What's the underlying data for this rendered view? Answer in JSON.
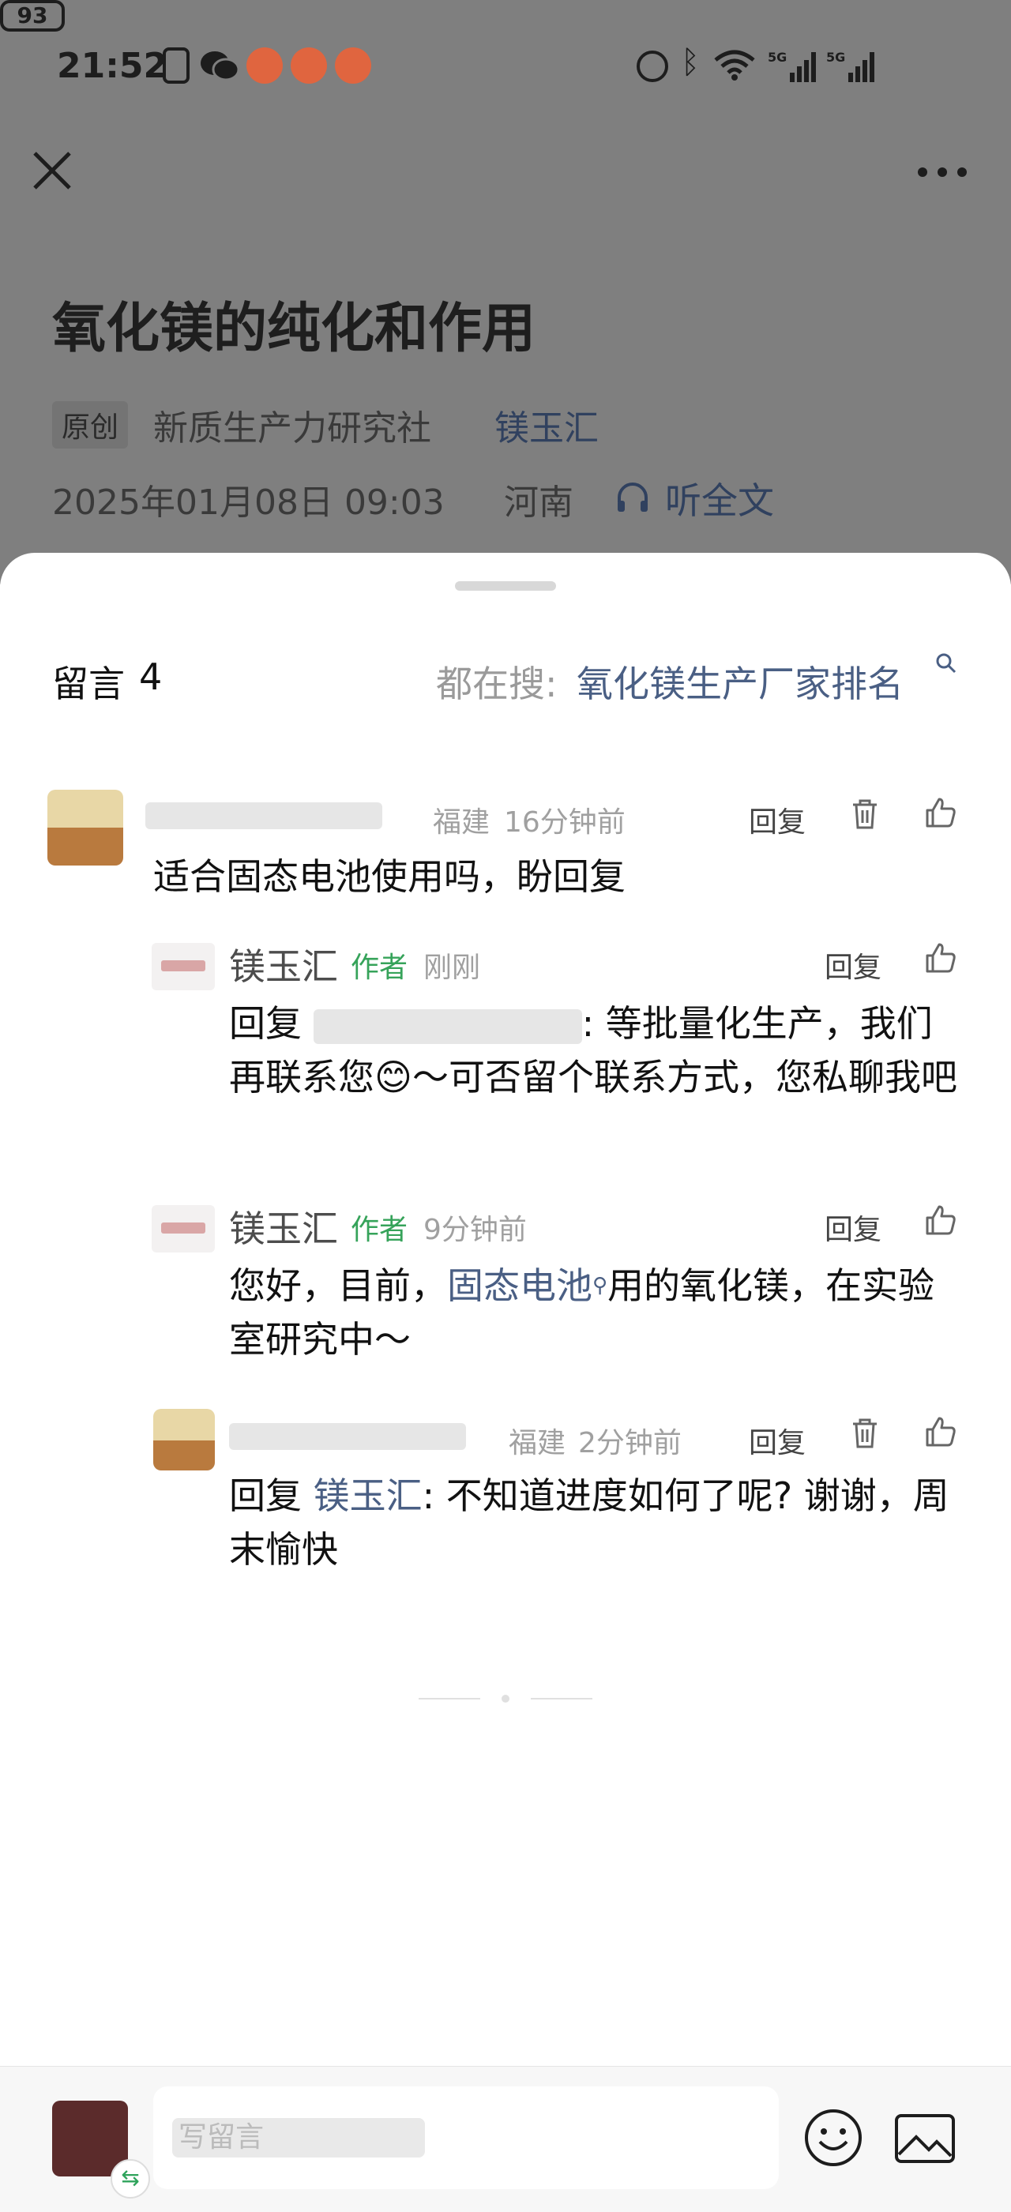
{
  "status_bar": {
    "time": "21:52",
    "battery": "93",
    "signal_labels": [
      "5G",
      "5G"
    ]
  },
  "article": {
    "title": "氧化镁的纯化和作用",
    "original_tag": "原创",
    "account": "新质生产力研究社",
    "author": "镁玉汇",
    "date": "2025年01月08日 09:03",
    "location": "河南",
    "listen_label": "听全文"
  },
  "comments_panel": {
    "title": "留言",
    "count": "4",
    "search_prefix": "都在搜:",
    "search_term": "氧化镁生产厂家排名",
    "comments": [
      {
        "location": "福建",
        "time": "16分钟前",
        "reply_label": "回复",
        "text": "适合固态电池使用吗，盼回复"
      },
      {
        "author": "镁玉汇",
        "author_tag": "作者",
        "time": "刚刚",
        "reply_label": "回复",
        "text_prefix": "回复",
        "text_rest": ": 等批量化生产，我们再联系您😊～可否留个联系方式，您私聊我吧"
      },
      {
        "author": "镁玉汇",
        "author_tag": "作者",
        "time": "9分钟前",
        "reply_label": "回复",
        "text_before": "您好，目前，",
        "text_link": "固态电池",
        "text_after": "用的氧化镁，在实验室研究中～"
      },
      {
        "location": "福建",
        "time": "2分钟前",
        "reply_label": "回复",
        "text_prefix": "回复",
        "text_mention": "镁玉汇",
        "text_rest": ": 不知道进度如何了呢? 谢谢，周末愉快"
      }
    ]
  },
  "input_bar": {
    "placeholder": "写留言"
  },
  "colors": {
    "link_blue": "#4a5f84",
    "author_green": "#36a35a",
    "overlay_gray": "#7f7f7f"
  },
  "icons": [
    "close-icon",
    "more-icon",
    "headphones-icon",
    "search-icon",
    "delete-icon",
    "like-icon",
    "emoji-icon",
    "image-icon"
  ]
}
